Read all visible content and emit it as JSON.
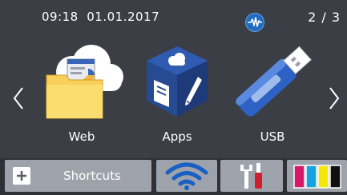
{
  "status_bar": {
    "datetime": "09:18  01.01.2017",
    "page_indicator": "2 / 3",
    "wifi_status_icon": "wifi-signal-status-icon"
  },
  "tiles": [
    {
      "label": "Web",
      "icon": "cloud-folder-icon"
    },
    {
      "label": "Apps",
      "icon": "apps-cube-icon"
    },
    {
      "label": "USB",
      "icon": "usb-drive-icon"
    }
  ],
  "bottom_bar": {
    "shortcuts_label": "Shortcuts",
    "wifi_icon": "wifi-icon",
    "settings_icon": "tools-icon",
    "ink_icon": "ink-levels-icon"
  },
  "colors": {
    "background": "#3b3e44",
    "button": "#9ea3ab",
    "accent_blue": "#1f6cc0",
    "ink_magenta": "#d6186c",
    "ink_cyan": "#16a4e0",
    "ink_yellow": "#f4e50a",
    "ink_black": "#111111"
  }
}
